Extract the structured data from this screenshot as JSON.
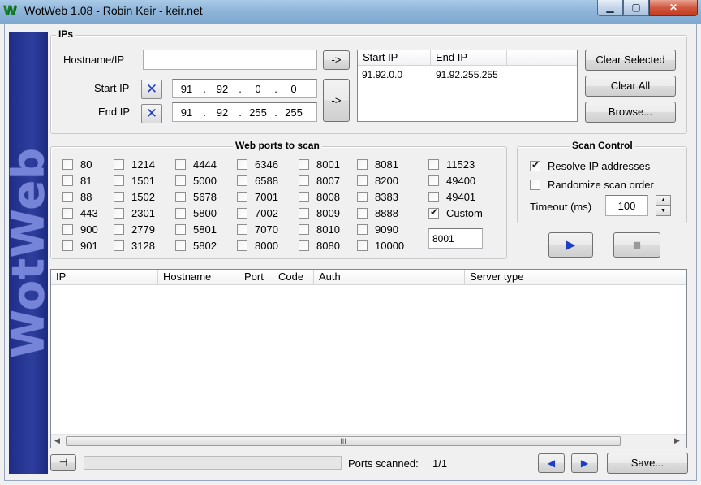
{
  "window": {
    "title": "WotWeb 1.08 - Robin Keir - keir.net",
    "logo_text": "W",
    "min_glyph": "▁",
    "max_glyph": "▢",
    "close_glyph": "✕"
  },
  "sidebar": {
    "text": "WotWeb"
  },
  "ips": {
    "legend": "IPs",
    "hostname_label": "Hostname/IP",
    "hostname_value": "",
    "add_host_label": "->",
    "start_ip_label": "Start IP",
    "end_ip_label": "End IP",
    "clear_glyph": "✕",
    "start_ip": [
      "91",
      "92",
      "0",
      "0"
    ],
    "end_ip": [
      "91",
      "92",
      "255",
      "255"
    ],
    "add_range_label": "->",
    "range_headers": [
      "Start IP",
      "End IP"
    ],
    "ranges": [
      {
        "start": "91.92.0.0",
        "end": "91.92.255.255"
      }
    ],
    "clear_selected_label": "Clear Selected",
    "clear_all_label": "Clear All",
    "browse_label": "Browse..."
  },
  "ports": {
    "legend": "Web ports to scan",
    "columns": [
      [
        {
          "label": "80",
          "checked": false
        },
        {
          "label": "81",
          "checked": false
        },
        {
          "label": "88",
          "checked": false
        },
        {
          "label": "443",
          "checked": false
        },
        {
          "label": "900",
          "checked": false
        },
        {
          "label": "901",
          "checked": false
        }
      ],
      [
        {
          "label": "1214",
          "checked": false
        },
        {
          "label": "1501",
          "checked": false
        },
        {
          "label": "1502",
          "checked": false
        },
        {
          "label": "2301",
          "checked": false
        },
        {
          "label": "2779",
          "checked": false
        },
        {
          "label": "3128",
          "checked": false
        }
      ],
      [
        {
          "label": "4444",
          "checked": false
        },
        {
          "label": "5000",
          "checked": false
        },
        {
          "label": "5678",
          "checked": false
        },
        {
          "label": "5800",
          "checked": false
        },
        {
          "label": "5801",
          "checked": false
        },
        {
          "label": "5802",
          "checked": false
        }
      ],
      [
        {
          "label": "6346",
          "checked": false
        },
        {
          "label": "6588",
          "checked": false
        },
        {
          "label": "7001",
          "checked": false
        },
        {
          "label": "7002",
          "checked": false
        },
        {
          "label": "7070",
          "checked": false
        },
        {
          "label": "8000",
          "checked": false
        }
      ],
      [
        {
          "label": "8001",
          "checked": false
        },
        {
          "label": "8007",
          "checked": false
        },
        {
          "label": "8008",
          "checked": false
        },
        {
          "label": "8009",
          "checked": false
        },
        {
          "label": "8010",
          "checked": false
        },
        {
          "label": "8080",
          "checked": false
        }
      ],
      [
        {
          "label": "8081",
          "checked": false
        },
        {
          "label": "8200",
          "checked": false
        },
        {
          "label": "8383",
          "checked": false
        },
        {
          "label": "8888",
          "checked": false
        },
        {
          "label": "9090",
          "checked": false
        },
        {
          "label": "10000",
          "checked": false
        }
      ],
      [
        {
          "label": "11523",
          "checked": false
        },
        {
          "label": "49400",
          "checked": false
        },
        {
          "label": "49401",
          "checked": false
        },
        {
          "label": "Custom",
          "checked": true
        }
      ]
    ],
    "custom_value": "8001"
  },
  "scan_control": {
    "legend": "Scan Control",
    "resolve_label": "Resolve IP addresses",
    "resolve_checked": true,
    "randomize_label": "Randomize scan order",
    "randomize_checked": false,
    "timeout_label": "Timeout (ms)",
    "timeout_value": "100",
    "spin_up": "▲",
    "spin_down": "▼",
    "start_glyph": "▶",
    "stop_glyph": "■"
  },
  "results": {
    "headers": [
      "IP",
      "Hostname",
      "Port",
      "Code",
      "Auth",
      "Server type"
    ],
    "rows": [],
    "scroll_left": "◀",
    "scroll_right": "▶",
    "scroll_grip": "III"
  },
  "statusbar": {
    "pin_glyph": "⊣",
    "progress_fraction": 0,
    "ports_scanned_label": "Ports scanned:",
    "ports_scanned_value": "1/1",
    "prev_glyph": "◀",
    "next_glyph": "▶",
    "save_label": "Save..."
  },
  "colors": {
    "sidebar_bg": "#26358f",
    "sidebar_text": "#7584d9",
    "accent_blue": "#1d3fc8",
    "titlebar": "#8fb5d9"
  }
}
